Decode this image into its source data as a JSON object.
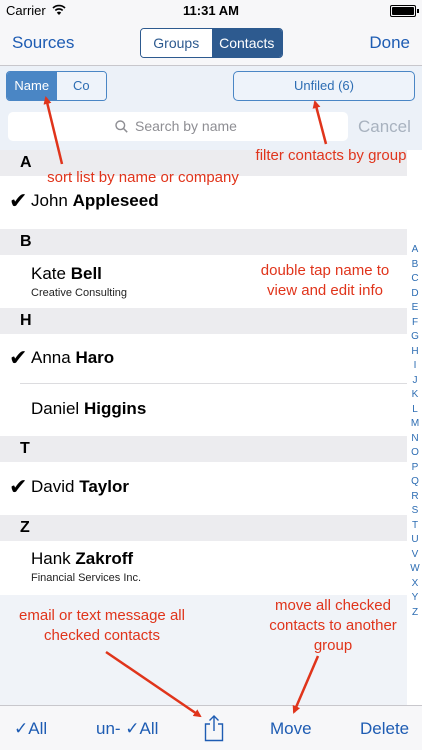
{
  "status": {
    "carrier": "Carrier",
    "time": "11:31 AM",
    "battery_level": 1.0
  },
  "nav": {
    "left": "Sources",
    "right": "Done",
    "segments": [
      "Groups",
      "Contacts"
    ],
    "active_segment": 1
  },
  "filter": {
    "sort_segments": [
      "Name",
      "Co"
    ],
    "active_sort": 0,
    "group_button": "Unfiled (6)"
  },
  "search": {
    "placeholder": "Search by name",
    "cancel": "Cancel"
  },
  "sections": [
    {
      "letter": "A",
      "rows": [
        {
          "first": "John",
          "last": "Appleseed",
          "company": "",
          "checked": true
        }
      ]
    },
    {
      "letter": "B",
      "rows": [
        {
          "first": "Kate",
          "last": "Bell",
          "company": "Creative Consulting",
          "checked": false
        }
      ]
    },
    {
      "letter": "H",
      "rows": [
        {
          "first": "Anna",
          "last": "Haro",
          "company": "",
          "checked": true
        },
        {
          "first": "Daniel",
          "last": "Higgins",
          "company": "",
          "checked": false
        }
      ]
    },
    {
      "letter": "T",
      "rows": [
        {
          "first": "David",
          "last": "Taylor",
          "company": "",
          "checked": true
        }
      ]
    },
    {
      "letter": "Z",
      "rows": [
        {
          "first": "Hank",
          "last": "Zakroff",
          "company": "Financial Services Inc.",
          "checked": false
        }
      ]
    }
  ],
  "check_mark": "✔",
  "index": [
    "A",
    "B",
    "C",
    "D",
    "E",
    "F",
    "G",
    "H",
    "I",
    "J",
    "K",
    "L",
    "M",
    "N",
    "O",
    "P",
    "Q",
    "R",
    "S",
    "T",
    "U",
    "V",
    "W",
    "X",
    "Y",
    "Z"
  ],
  "toolbar": {
    "check_all": "✓All",
    "uncheck_all": "un- ✓All",
    "move": "Move",
    "delete": "Delete"
  },
  "annotations": {
    "sort": "sort list by name or company",
    "filter": "filter contacts by group",
    "double_tap_1": "double tap name to",
    "double_tap_2": "view and edit info",
    "email_1": "email or text message all",
    "email_2": "checked contacts",
    "move_1": "move all checked",
    "move_2": "contacts to another",
    "move_3": "group"
  },
  "colors": {
    "accent": "#1e5cb3",
    "annotation": "#e0341b",
    "segment_active": "#2d5a8f"
  }
}
